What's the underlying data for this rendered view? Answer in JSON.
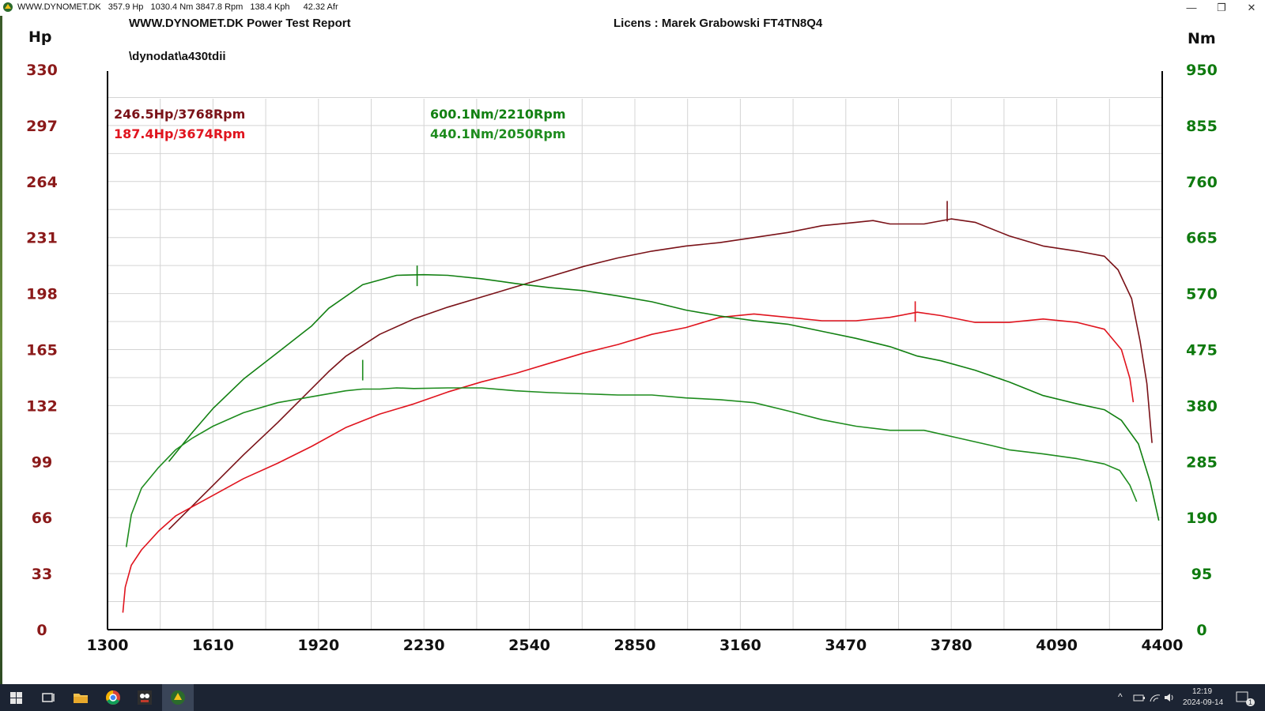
{
  "window": {
    "title_parts": [
      "WWW.DYNOMET.DK",
      "357.9 Hp",
      "1030.4 Nm 3847.8 Rpm",
      "138.4 Kph",
      "42.32 Afr"
    ],
    "controls": {
      "minimize": "—",
      "restore": "❐",
      "close": "✕"
    }
  },
  "header": {
    "report_title": "WWW.DYNOMET.DK  Power Test Report",
    "license": "Licens :  Marek Grabowski  FT4TN8Q4",
    "file_path": "\\dynodat\\a430tdii"
  },
  "chart_data": {
    "type": "line",
    "left_axis": {
      "label": "Hp",
      "ticks": [
        "330",
        "297",
        "264",
        "231",
        "198",
        "165",
        "132",
        "99",
        "66",
        "33",
        "0"
      ],
      "range": [
        0,
        330
      ]
    },
    "right_axis": {
      "label": "Nm",
      "ticks": [
        "950",
        "855",
        "760",
        "665",
        "570",
        "475",
        "380",
        "285",
        "190",
        "95",
        "0"
      ],
      "range": [
        0,
        950
      ]
    },
    "x_axis": {
      "ticks": [
        "1300",
        "1610",
        "1920",
        "2230",
        "2540",
        "2850",
        "3160",
        "3470",
        "3780",
        "4090",
        "4400"
      ],
      "range": [
        1300,
        4400
      ]
    },
    "grid": true,
    "annotations": {
      "power_tuned": "246.5Hp/3768Rpm",
      "power_stock": "187.4Hp/3674Rpm",
      "torque_tuned": "600.1Nm/2210Rpm",
      "torque_stock": "440.1Nm/2050Rpm"
    },
    "colors": {
      "power_tuned": "#7a1218",
      "power_stock": "#e0141e",
      "torque_tuned": "#128012",
      "torque_stock": "#1e8c1e",
      "left_ticks": "#8b1a1a",
      "right_ticks": "#0f7a0f"
    },
    "series": [
      {
        "key": "power_tuned",
        "axis": "left",
        "peak": [
          3768,
          246.5
        ],
        "points": [
          [
            1480,
            59
          ],
          [
            1550,
            73
          ],
          [
            1610,
            85
          ],
          [
            1700,
            103
          ],
          [
            1800,
            122
          ],
          [
            1870,
            136
          ],
          [
            1950,
            152
          ],
          [
            2000,
            161
          ],
          [
            2100,
            174
          ],
          [
            2200,
            183
          ],
          [
            2300,
            190
          ],
          [
            2400,
            196
          ],
          [
            2500,
            202
          ],
          [
            2600,
            208
          ],
          [
            2700,
            214
          ],
          [
            2800,
            219
          ],
          [
            2900,
            223
          ],
          [
            3000,
            226
          ],
          [
            3100,
            228
          ],
          [
            3200,
            231
          ],
          [
            3300,
            234
          ],
          [
            3400,
            238
          ],
          [
            3500,
            240
          ],
          [
            3550,
            241
          ],
          [
            3600,
            239
          ],
          [
            3700,
            239
          ],
          [
            3780,
            242
          ],
          [
            3850,
            240
          ],
          [
            3950,
            232
          ],
          [
            4050,
            226
          ],
          [
            4150,
            223
          ],
          [
            4230,
            220
          ],
          [
            4270,
            212
          ],
          [
            4310,
            195
          ],
          [
            4335,
            170
          ],
          [
            4355,
            145
          ],
          [
            4370,
            110
          ]
        ]
      },
      {
        "key": "power_stock",
        "axis": "left",
        "peak": [
          3674,
          187.4
        ],
        "points": [
          [
            1345,
            10
          ],
          [
            1352,
            25
          ],
          [
            1370,
            38
          ],
          [
            1400,
            47
          ],
          [
            1450,
            58
          ],
          [
            1500,
            67
          ],
          [
            1600,
            78
          ],
          [
            1700,
            89
          ],
          [
            1800,
            98
          ],
          [
            1900,
            108
          ],
          [
            2000,
            119
          ],
          [
            2100,
            127
          ],
          [
            2200,
            133
          ],
          [
            2300,
            140
          ],
          [
            2400,
            146
          ],
          [
            2500,
            151
          ],
          [
            2600,
            157
          ],
          [
            2700,
            163
          ],
          [
            2800,
            168
          ],
          [
            2900,
            174
          ],
          [
            3000,
            178
          ],
          [
            3100,
            184
          ],
          [
            3200,
            186
          ],
          [
            3300,
            184
          ],
          [
            3400,
            182
          ],
          [
            3500,
            182
          ],
          [
            3600,
            184
          ],
          [
            3680,
            187
          ],
          [
            3750,
            185
          ],
          [
            3850,
            181
          ],
          [
            3950,
            181
          ],
          [
            4050,
            183
          ],
          [
            4150,
            181
          ],
          [
            4230,
            177
          ],
          [
            4280,
            165
          ],
          [
            4305,
            148
          ],
          [
            4315,
            134
          ]
        ]
      },
      {
        "key": "torque_tuned",
        "axis": "right",
        "peak": [
          2210,
          600.1
        ],
        "points": [
          [
            1480,
            285
          ],
          [
            1550,
            335
          ],
          [
            1610,
            375
          ],
          [
            1700,
            425
          ],
          [
            1800,
            470
          ],
          [
            1900,
            515
          ],
          [
            1950,
            545
          ],
          [
            2050,
            585
          ],
          [
            2150,
            601
          ],
          [
            2230,
            602
          ],
          [
            2300,
            601
          ],
          [
            2400,
            595
          ],
          [
            2500,
            587
          ],
          [
            2600,
            580
          ],
          [
            2700,
            575
          ],
          [
            2800,
            566
          ],
          [
            2900,
            556
          ],
          [
            3000,
            542
          ],
          [
            3100,
            532
          ],
          [
            3200,
            524
          ],
          [
            3300,
            518
          ],
          [
            3400,
            506
          ],
          [
            3500,
            494
          ],
          [
            3600,
            480
          ],
          [
            3680,
            464
          ],
          [
            3750,
            456
          ],
          [
            3850,
            440
          ],
          [
            3950,
            420
          ],
          [
            4050,
            397
          ],
          [
            4150,
            383
          ],
          [
            4230,
            373
          ],
          [
            4280,
            355
          ],
          [
            4330,
            315
          ],
          [
            4365,
            250
          ],
          [
            4390,
            185
          ]
        ]
      },
      {
        "key": "torque_stock",
        "axis": "right",
        "peak": [
          2050,
          440.1
        ],
        "points": [
          [
            1355,
            140
          ],
          [
            1370,
            195
          ],
          [
            1400,
            240
          ],
          [
            1450,
            275
          ],
          [
            1500,
            305
          ],
          [
            1550,
            325
          ],
          [
            1610,
            345
          ],
          [
            1700,
            368
          ],
          [
            1800,
            385
          ],
          [
            1900,
            395
          ],
          [
            2000,
            405
          ],
          [
            2050,
            408
          ],
          [
            2100,
            408
          ],
          [
            2150,
            410
          ],
          [
            2200,
            409
          ],
          [
            2300,
            410
          ],
          [
            2400,
            410
          ],
          [
            2500,
            405
          ],
          [
            2600,
            402
          ],
          [
            2700,
            400
          ],
          [
            2800,
            398
          ],
          [
            2900,
            398
          ],
          [
            3000,
            393
          ],
          [
            3100,
            390
          ],
          [
            3200,
            385
          ],
          [
            3300,
            371
          ],
          [
            3400,
            356
          ],
          [
            3500,
            345
          ],
          [
            3600,
            338
          ],
          [
            3700,
            338
          ],
          [
            3800,
            325
          ],
          [
            3900,
            312
          ],
          [
            3950,
            305
          ],
          [
            4050,
            298
          ],
          [
            4150,
            290
          ],
          [
            4230,
            281
          ],
          [
            4275,
            270
          ],
          [
            4305,
            245
          ],
          [
            4325,
            217
          ]
        ]
      }
    ]
  },
  "taskbar": {
    "icons": [
      "windows-start-icon",
      "task-view-icon",
      "file-explorer-icon",
      "chrome-icon",
      "app-mascot-icon",
      "dynomet-app-icon"
    ],
    "time": "12:19",
    "date": "2024-09-14",
    "notification_count": "1"
  }
}
